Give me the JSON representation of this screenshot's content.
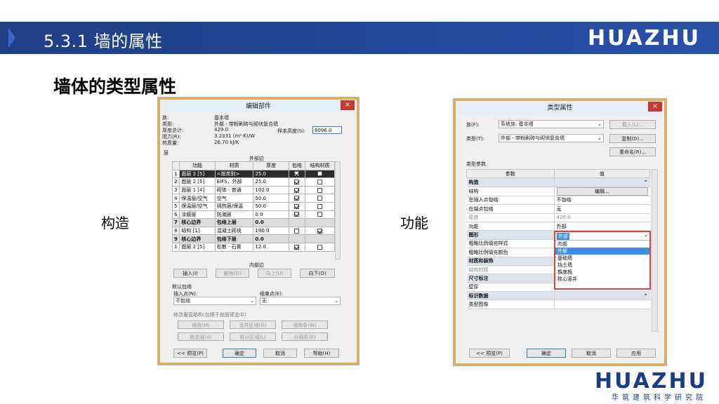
{
  "header": {
    "title": "5.3.1  墙的属性",
    "logo": "HUAZHU"
  },
  "subtitle": "墙体的类型属性",
  "captions": {
    "left": "构造",
    "right": "功能"
  },
  "dialog_left": {
    "title": "编辑部件",
    "close": "×",
    "info": {
      "family_label": "族:",
      "family_value": "基本墙",
      "type_label": "类型:",
      "type_value": "外部 - 带粉刷砖与砌块复合墙",
      "thickness_label": "厚度总计:",
      "thickness_value": "429.0",
      "sample_height_label": "样本高度(S):",
      "sample_height_value": "6096.0",
      "resistance_label": "阻力(R):",
      "resistance_value": "3.2331 (m²·K)/W",
      "thermal_label": "热质量:",
      "thermal_value": "26.70 kJ/K"
    },
    "layers_label": "层",
    "exterior_side": "外部边",
    "interior_side": "内部边",
    "columns": [
      "",
      "功能",
      "材质",
      "厚度",
      "包络",
      "结构材质"
    ],
    "rows": [
      {
        "n": "1",
        "func": "面层 2 [5]",
        "mat": "<按类别>",
        "thk": "25.0",
        "wrap": true,
        "struct": false,
        "style": "sel"
      },
      {
        "n": "2",
        "func": "面层 2 [5]",
        "mat": "EIFS，外部",
        "thk": "25.0",
        "wrap": true,
        "struct": false,
        "style": ""
      },
      {
        "n": "3",
        "func": "面层 1 [4]",
        "mat": "砌体 - 普通",
        "thk": "102.0",
        "wrap": true,
        "struct": false,
        "style": ""
      },
      {
        "n": "4",
        "func": "保温层/空气",
        "mat": "空气",
        "thk": "50.0",
        "wrap": true,
        "struct": false,
        "style": ""
      },
      {
        "n": "5",
        "func": "保温层/空气",
        "mat": "隔热层/保温",
        "thk": "50.0",
        "wrap": true,
        "struct": false,
        "style": ""
      },
      {
        "n": "6",
        "func": "涂膜层",
        "mat": "防潮层",
        "thk": "0.0",
        "wrap": true,
        "struct": false,
        "style": ""
      },
      {
        "n": "7",
        "func": "核心边界",
        "mat": "包络上层",
        "thk": "0.0",
        "wrap": null,
        "struct": null,
        "style": "core"
      },
      {
        "n": "8",
        "func": "结构 [1]",
        "mat": "混凝土砌块",
        "thk": "190.0",
        "wrap": false,
        "struct": true,
        "style": ""
      },
      {
        "n": "9",
        "func": "核心边界",
        "mat": "包络下层",
        "thk": "0.0",
        "wrap": null,
        "struct": null,
        "style": "core"
      },
      {
        "n": "1",
        "func": "面层 2 [5]",
        "mat": "松散 - 石膏",
        "thk": "12.0",
        "wrap": true,
        "struct": false,
        "style": ""
      }
    ],
    "buttons_row": [
      "插入(I)",
      "删除(D)",
      "向上(U)",
      "向下(O)"
    ],
    "default_wrap_label": "默认包络",
    "insert_point_label": "插入点(N):",
    "insert_point_value": "不包络",
    "end_point_label": "结束点(E):",
    "end_point_value": "无",
    "modify_label": "修改垂直结构(仅限于剖面预览中)",
    "modify_buttons": [
      "修改(M)",
      "合并区域(G)",
      "墙饰条(W)",
      "指定层(A)",
      "拆分区域(L)",
      "分隔条(R)"
    ],
    "footer_buttons": [
      "<< 预览(P)",
      "确定",
      "取消",
      "帮助(H)"
    ]
  },
  "dialog_right": {
    "title": "类型属性",
    "close": "×",
    "family_label": "族(F):",
    "family_value": "系统族: 基本墙",
    "type_label": "类型(T):",
    "type_value": "外部 - 带粉刷砖与砌块复合墙",
    "load_button": "载入(L)...",
    "duplicate_button": "复制(D)...",
    "rename_button": "重命名(R)...",
    "type_params_label": "类型参数",
    "columns": [
      "参数",
      "值"
    ],
    "rows": [
      {
        "kind": "group",
        "p": "构造",
        "v": ""
      },
      {
        "kind": "row",
        "p": "结构",
        "v": "编辑..."
      },
      {
        "kind": "row",
        "p": "在插入点包络",
        "v": "不包络"
      },
      {
        "kind": "row",
        "p": "在端点包络",
        "v": "无"
      },
      {
        "kind": "muted",
        "p": "厚度",
        "v": "429.0"
      },
      {
        "kind": "row",
        "p": "功能",
        "v": "外部"
      },
      {
        "kind": "group",
        "p": "图形",
        "v": ""
      },
      {
        "kind": "row",
        "p": "粗略比例填充样式",
        "v": ""
      },
      {
        "kind": "row",
        "p": "粗略比例填充颜色",
        "v": ""
      },
      {
        "kind": "group",
        "p": "材质和装饰",
        "v": ""
      },
      {
        "kind": "muted",
        "p": "结构材质",
        "v": ""
      },
      {
        "kind": "group",
        "p": "尺寸标注",
        "v": ""
      },
      {
        "kind": "row",
        "p": "壁厚",
        "v": ""
      },
      {
        "kind": "group",
        "p": "标识数据",
        "v": ""
      },
      {
        "kind": "row",
        "p": "类型图像",
        "v": ""
      }
    ],
    "dropdown_options": [
      "内部",
      "外部",
      "基础墙",
      "挡土墙",
      "檐底板",
      "核心竖井"
    ],
    "dropdown_selected_index": 1,
    "footer_buttons": [
      "<< 预览(P)",
      "确定",
      "取消",
      "应用"
    ]
  },
  "footer": {
    "logo": "HUAZHU",
    "sub": "华筑建筑科学研究院"
  },
  "colors": {
    "header_bg": "#22469a",
    "brand_blue": "#1b3d86",
    "dialog_border": "#e8ac4c",
    "dropdown_border": "#e04040"
  }
}
